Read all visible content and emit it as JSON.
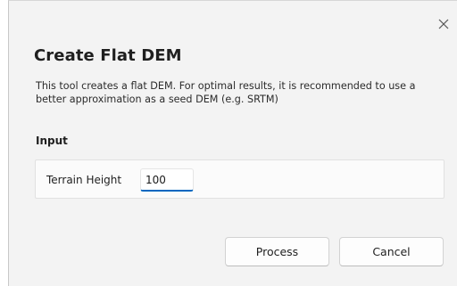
{
  "dialog": {
    "close_icon": "close-icon",
    "title": "Create Flat DEM",
    "description": "This tool creates a flat DEM.  For optimal results, it is recommended to use a better approximation as a seed DEM (e.g. SRTM)"
  },
  "input_section": {
    "label": "Input",
    "terrain_height_label": "Terrain Height",
    "terrain_height_value": "100"
  },
  "buttons": {
    "process_label": "Process",
    "cancel_label": "Cancel"
  },
  "colors": {
    "dialog_background": "#f3f3f3",
    "accent": "#0067c0"
  }
}
